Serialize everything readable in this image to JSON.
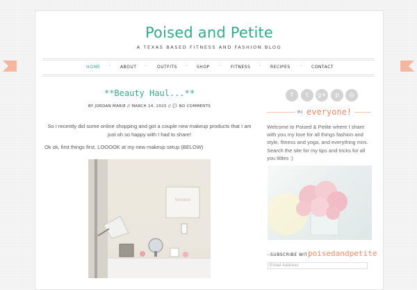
{
  "header": {
    "title": "Poised and Petite",
    "tagline": "A TEXAS BASED FITNESS AND FASHION BLOG"
  },
  "nav": {
    "items": [
      "HOME",
      "ABOUT",
      "OUTFITS",
      "SHOP",
      "FITNESS",
      "RECIPES",
      "CONTACT"
    ],
    "separator": "-"
  },
  "post": {
    "title": "**Beauty Haul...**",
    "byline": "BY JORDAN MARIE // MARCH 14, 2015 // 💬 NO COMMENTS",
    "paragraph1": "So I recently did some online shopping and got a couple new makeup products that I am just oh so happy with I had to share!",
    "paragraph2": "Ok ok, first things first. LOOOOK at my new makeup setup (BELOW)",
    "art_print_text": "WOMAN"
  },
  "sidebar": {
    "social_icons": [
      "facebook-icon",
      "twitter-icon",
      "google-plus-icon",
      "pinterest-icon",
      "instagram-icon"
    ],
    "social_glyphs": [
      "f",
      "t",
      "g+",
      "p",
      "◎"
    ],
    "hi_small": "HI",
    "hi_big": "everyone!",
    "welcome": "Welcome to Poised & Petite where I share with you my love for all things fashion and style, fitness and yoga, and everything mini. Search the site for my tips and tricks for all you littles :)",
    "subscribe_small": "SUBSCRIBE WITH",
    "subscribe_big": "poisedandpetite",
    "email_placeholder": "Email Address"
  },
  "colors": {
    "accent_green": "#33aa88",
    "accent_coral": "#f28a6a",
    "ribbon": "#f5b6a0"
  }
}
